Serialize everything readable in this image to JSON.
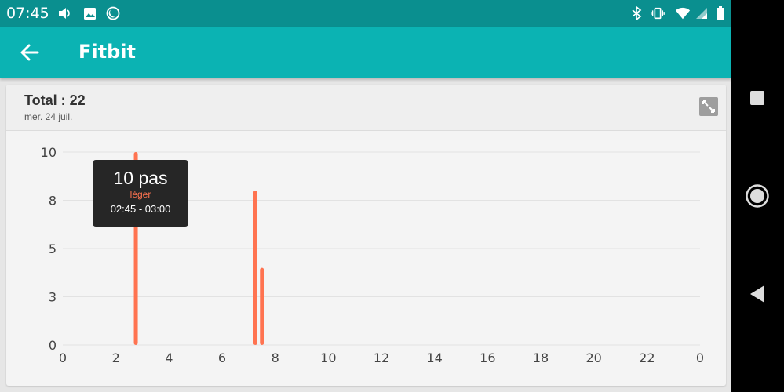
{
  "status_bar": {
    "time": "07:45"
  },
  "app_bar": {
    "title": "Fitbit"
  },
  "card": {
    "total": "Total : 22",
    "date": "mer. 24 juil."
  },
  "tooltip": {
    "steps": "10 pas",
    "level": "léger",
    "range": "02:45 - 03:00"
  },
  "colors": {
    "status_bar": "#0a8f8f",
    "app_bar": "#0bb3b3",
    "bar": "#ff7350",
    "tooltip_bg": "#262626"
  },
  "chart_data": {
    "type": "bar",
    "y_tick_labels": [
      "0",
      "3",
      "5",
      "8",
      "10"
    ],
    "y_tick_values": [
      0,
      2.5,
      5,
      7.5,
      10
    ],
    "x_tick_labels": [
      "0",
      "2",
      "4",
      "6",
      "8",
      "10",
      "12",
      "14",
      "16",
      "18",
      "20",
      "22",
      "0"
    ],
    "x_tick_values": [
      0,
      2,
      4,
      6,
      8,
      10,
      12,
      14,
      16,
      18,
      20,
      22,
      24
    ],
    "xlim": [
      0,
      24
    ],
    "ylim": [
      0,
      10
    ],
    "grid": true,
    "bars": [
      {
        "x": 2.75,
        "value": 10
      },
      {
        "x": 7.25,
        "value": 8
      },
      {
        "x": 7.5,
        "value": 4
      }
    ]
  }
}
